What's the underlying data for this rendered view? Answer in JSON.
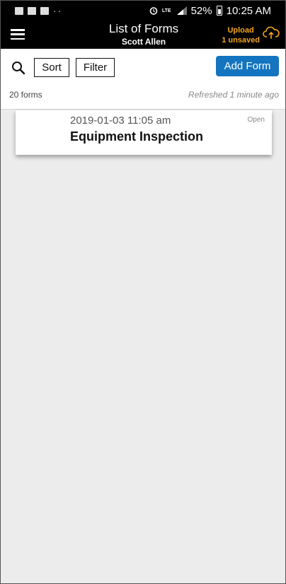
{
  "status_bar": {
    "time": "10:25 AM",
    "battery": "52%",
    "network": "LTE",
    "icons": [
      "gallery-icon",
      "outlook-icon",
      "mail-icon",
      "more-dots-icon",
      "alarm-icon",
      "signal-icon",
      "battery-icon"
    ]
  },
  "header": {
    "title": "List of Forms",
    "subtitle": "Scott Allen",
    "upload_label": "Upload",
    "unsaved_label": "1 unsaved",
    "accent_color": "#f4a51c"
  },
  "toolbar": {
    "sort_label": "Sort",
    "filter_label": "Filter",
    "add_label": "Add Form",
    "add_color": "#1474bf",
    "count_text": "20 forms",
    "refreshed_text": "Refreshed 1 minute ago"
  },
  "forms": [
    {
      "date": "2019-01-03 11:05 am",
      "title": "Equipment Inspection",
      "status": "Open"
    }
  ]
}
